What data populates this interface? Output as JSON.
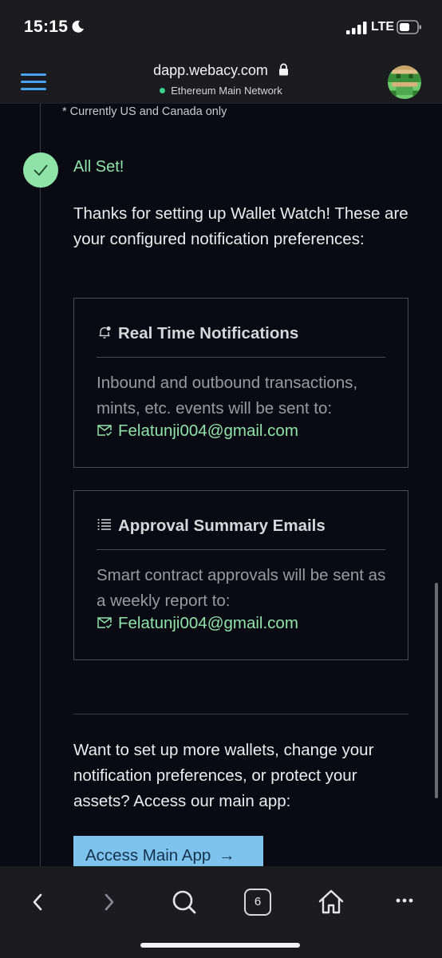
{
  "status_bar": {
    "time": "15:15",
    "network": "LTE",
    "icons": [
      "moon-icon",
      "signal-icon",
      "battery-icon"
    ]
  },
  "browser": {
    "domain": "dapp.webacy.com",
    "network_label": "Ethereum Main Network",
    "icons": [
      "menu-icon",
      "lock-icon",
      "avatar"
    ]
  },
  "content": {
    "footnote": "* Currently US and Canada only",
    "status_title": "All Set!",
    "intro": "Thanks for setting up Wallet Watch! These are your configured notification preferences:",
    "cards": [
      {
        "title": "Real Time Notifications",
        "icon": "bell-icon",
        "body": "Inbound and outbound transactions, mints, etc. events will be sent to:",
        "email": "Felatunji004@gmail.com"
      },
      {
        "title": "Approval Summary Emails",
        "icon": "list-icon",
        "body": "Smart contract approvals will be sent as a weekly report to:",
        "email": "Felatunji004@gmail.com"
      }
    ],
    "more_text": "Want to set up more wallets, change your notification preferences, or protect your assets? Access our main app:",
    "cta_label": "Access Main App",
    "cta_arrow": "→"
  },
  "toolbar": {
    "tab_count": "6",
    "icons": [
      "back-icon",
      "forward-icon",
      "search-icon",
      "tabs-icon",
      "home-icon",
      "more-icon"
    ]
  },
  "colors": {
    "accent_green": "#8fe3a8",
    "cta_blue": "#7ec3ee",
    "menu_blue": "#4aa3f0"
  }
}
